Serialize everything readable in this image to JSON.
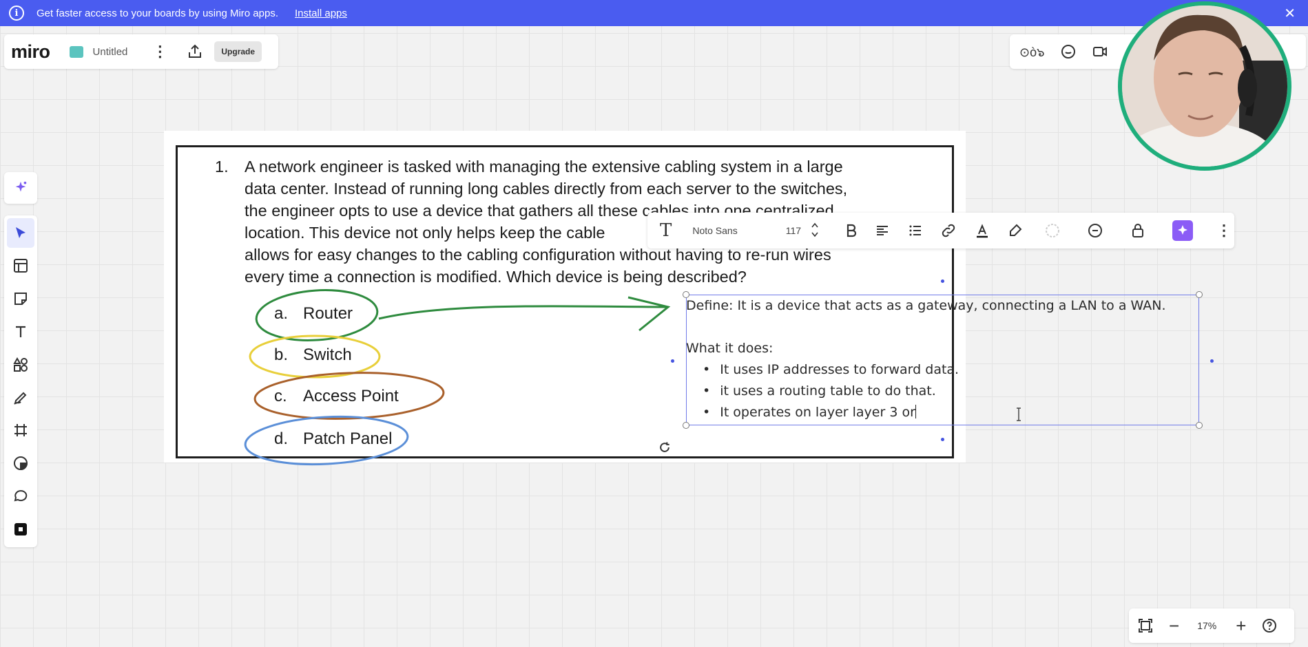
{
  "banner": {
    "message": "Get faster access to your boards by using Miro apps.",
    "install_label": "Install apps",
    "close_label": "✕",
    "color": "#4a5cf0"
  },
  "board_bar": {
    "logo": "miro",
    "board_name": "Untitled",
    "kebab": "⋮",
    "upgrade_label": "Upgrade"
  },
  "right_bar": {
    "reactions": "⊙ò๖"
  },
  "document": {
    "question_number": "1.",
    "question_lines": [
      "A network engineer is tasked with managing the extensive cabling system in a large",
      "data center. Instead of running long cables directly from each server to the switches,",
      "the engineer opts to use a device that gathers all these cables into one centralized",
      "location. This device not only helps keep the cable",
      "allows for easy changes to the cabling configuration without having to re-run wires",
      "every time a connection is modified. Which device is being described?"
    ],
    "options": [
      {
        "letter": "a.",
        "label": "Router",
        "circle_color": "#2e8b3e"
      },
      {
        "letter": "b.",
        "label": "Switch",
        "circle_color": "#e8cf3a"
      },
      {
        "letter": "c.",
        "label": "Access Point",
        "circle_color": "#a9602b"
      },
      {
        "letter": "d.",
        "label": "Patch Panel",
        "circle_color": "#5b8fd8"
      }
    ]
  },
  "text_toolbar": {
    "text_icon": "T",
    "font_name": "Noto Sans",
    "font_size": "117",
    "stepper": "⌃\n⌄",
    "more": "⋮",
    "accent": "#8b5cf6"
  },
  "textbox": {
    "define": "Define: It is a device that acts as a gateway, connecting a LAN to a WAN.",
    "what_it_does": "What it does:",
    "bullets": [
      "It uses IP addresses to forward data.",
      "it uses a routing table to do that.",
      "It operates on layer layer 3 or"
    ]
  },
  "zoom": {
    "minus": "−",
    "level": "17%",
    "plus": "+"
  }
}
